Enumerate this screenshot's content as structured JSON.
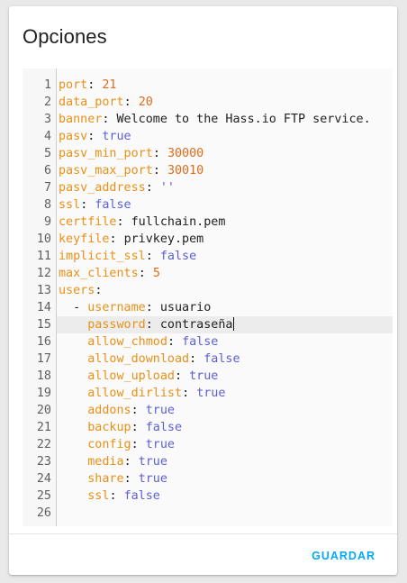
{
  "card": {
    "title": "Opciones",
    "save_label": "GUARDAR"
  },
  "colors": {
    "key": "#e89017",
    "number": "#e06c18",
    "boolean": "#5c5fd6",
    "accent": "#03a9f4"
  },
  "editor": {
    "active_line": 15,
    "lines": [
      {
        "n": "1",
        "indent": "",
        "dash": "",
        "key": "port",
        "value": "21",
        "vtype": "n"
      },
      {
        "n": "2",
        "indent": "",
        "dash": "",
        "key": "data_port",
        "value": "20",
        "vtype": "n"
      },
      {
        "n": "3",
        "indent": "",
        "dash": "",
        "key": "banner",
        "value": "Welcome to the Hass.io FTP service.",
        "vtype": "s"
      },
      {
        "n": "4",
        "indent": "",
        "dash": "",
        "key": "pasv",
        "value": "true",
        "vtype": "b"
      },
      {
        "n": "5",
        "indent": "",
        "dash": "",
        "key": "pasv_min_port",
        "value": "30000",
        "vtype": "n"
      },
      {
        "n": "6",
        "indent": "",
        "dash": "",
        "key": "pasv_max_port",
        "value": "30010",
        "vtype": "n"
      },
      {
        "n": "7",
        "indent": "",
        "dash": "",
        "key": "pasv_address",
        "value": "''",
        "vtype": "q"
      },
      {
        "n": "8",
        "indent": "",
        "dash": "",
        "key": "ssl",
        "value": "false",
        "vtype": "b"
      },
      {
        "n": "9",
        "indent": "",
        "dash": "",
        "key": "certfile",
        "value": "fullchain.pem",
        "vtype": "s"
      },
      {
        "n": "10",
        "indent": "",
        "dash": "",
        "key": "keyfile",
        "value": "privkey.pem",
        "vtype": "s"
      },
      {
        "n": "11",
        "indent": "",
        "dash": "",
        "key": "implicit_ssl",
        "value": "false",
        "vtype": "b"
      },
      {
        "n": "12",
        "indent": "",
        "dash": "",
        "key": "max_clients",
        "value": "5",
        "vtype": "n"
      },
      {
        "n": "13",
        "indent": "",
        "dash": "",
        "key": "users",
        "value": "",
        "vtype": "s"
      },
      {
        "n": "14",
        "indent": "  ",
        "dash": "- ",
        "key": "username",
        "value": "usuario",
        "vtype": "s"
      },
      {
        "n": "15",
        "indent": "    ",
        "dash": "",
        "key": "password",
        "value": "contraseña",
        "vtype": "s"
      },
      {
        "n": "16",
        "indent": "    ",
        "dash": "",
        "key": "allow_chmod",
        "value": "false",
        "vtype": "b"
      },
      {
        "n": "17",
        "indent": "    ",
        "dash": "",
        "key": "allow_download",
        "value": "false",
        "vtype": "b"
      },
      {
        "n": "18",
        "indent": "    ",
        "dash": "",
        "key": "allow_upload",
        "value": "true",
        "vtype": "b"
      },
      {
        "n": "19",
        "indent": "    ",
        "dash": "",
        "key": "allow_dirlist",
        "value": "true",
        "vtype": "b"
      },
      {
        "n": "20",
        "indent": "    ",
        "dash": "",
        "key": "addons",
        "value": "true",
        "vtype": "b"
      },
      {
        "n": "21",
        "indent": "    ",
        "dash": "",
        "key": "backup",
        "value": "false",
        "vtype": "b"
      },
      {
        "n": "22",
        "indent": "    ",
        "dash": "",
        "key": "config",
        "value": "true",
        "vtype": "b"
      },
      {
        "n": "23",
        "indent": "    ",
        "dash": "",
        "key": "media",
        "value": "true",
        "vtype": "b"
      },
      {
        "n": "24",
        "indent": "    ",
        "dash": "",
        "key": "share",
        "value": "true",
        "vtype": "b"
      },
      {
        "n": "25",
        "indent": "    ",
        "dash": "",
        "key": "ssl",
        "value": "false",
        "vtype": "b"
      },
      {
        "n": "26",
        "indent": "",
        "dash": "",
        "key": "",
        "value": "",
        "vtype": "s"
      }
    ]
  }
}
